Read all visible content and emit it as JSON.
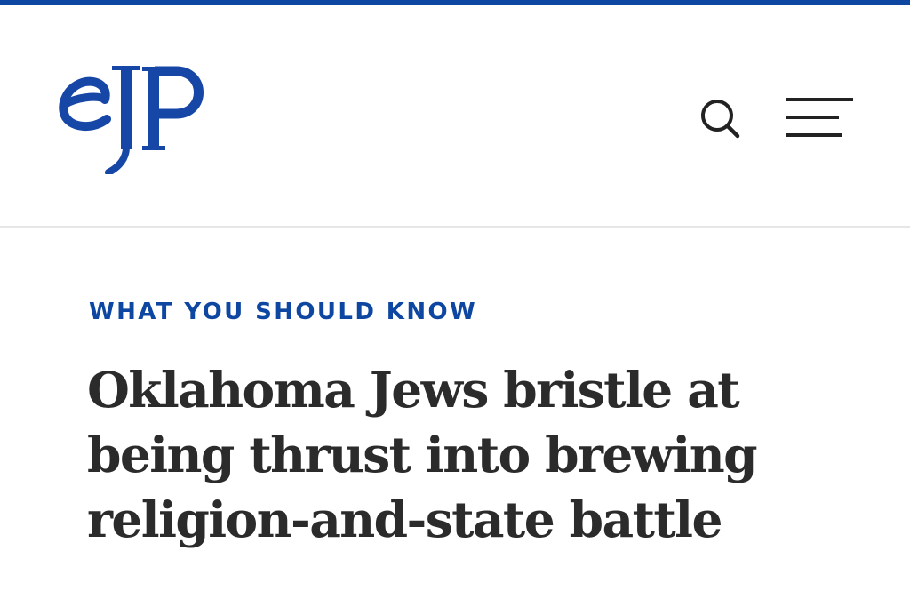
{
  "header": {
    "logo_text": "eJP",
    "logo_color": "#1747a6",
    "accent_color": "#0d47a1",
    "search_icon": "search-icon",
    "menu_icon": "hamburger-menu-icon"
  },
  "article": {
    "kicker": "WHAT YOU SHOULD KNOW",
    "headline_lines": [
      "Oklahoma Jews bristle at",
      "being thrust into brewing",
      "religion-and-state battle"
    ]
  }
}
